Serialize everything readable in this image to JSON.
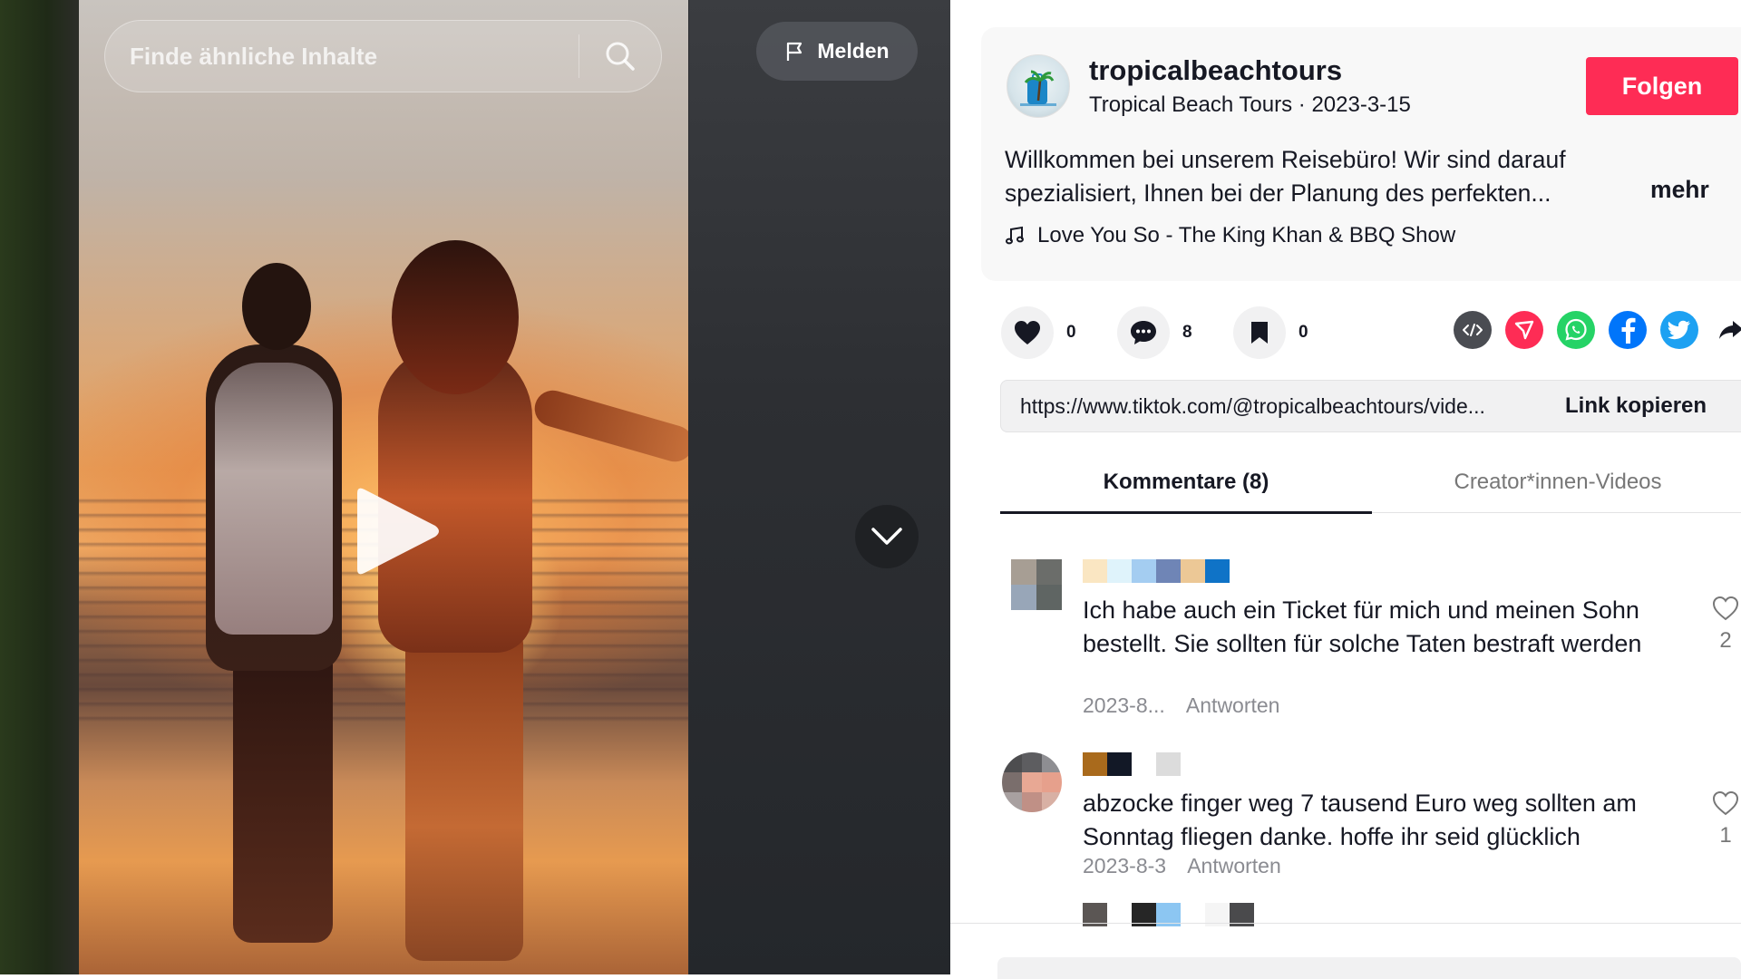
{
  "video": {
    "search_placeholder": "Finde ähnliche Inhalte",
    "report_label": "Melden"
  },
  "author": {
    "username": "tropicalbeachtours",
    "display_name": "Tropical Beach Tours",
    "separator": "·",
    "date": "2023-3-15",
    "follow_label": "Folgen",
    "description": "Willkommen bei unserem Reisebüro! Wir sind darauf spezialisiert, Ihnen bei der Planung des perfekten...",
    "more_label": "mehr",
    "music": "Love You So - The King Khan & BBQ Show"
  },
  "stats": {
    "likes": "0",
    "comments": "8",
    "saves": "0"
  },
  "share": {
    "icons": [
      "embed-icon",
      "tiktok-send-icon",
      "whatsapp-icon",
      "facebook-icon",
      "twitter-icon",
      "share-arrow-icon"
    ],
    "colors": {
      "embed": "#4a4c52",
      "send": "#fe2c55",
      "whatsapp": "#25d366",
      "facebook": "#0075fa",
      "twitter": "#1da1f2"
    }
  },
  "link": {
    "url": "https://www.tiktok.com/@tropicalbeachtours/vide...",
    "copy_label": "Link kopieren"
  },
  "tabs": {
    "comments": "Kommentare (8)",
    "creator_videos": "Creator*innen-Videos"
  },
  "comments": [
    {
      "text": "Ich habe auch ein Ticket für mich und meinen Sohn bestellt. Sie sollten für solche Taten bestraft werden",
      "date": "2023-8...",
      "reply_label": "Antworten",
      "likes": "2"
    },
    {
      "text": "abzocke finger weg 7 tausend Euro weg sollten am Sonntag fliegen danke. hoffe ihr seid glücklich",
      "date": "2023-8-3",
      "reply_label": "Antworten",
      "likes": "1"
    }
  ],
  "theme": {
    "accent": "#fe2c55",
    "text": "#161823",
    "muted": "#8a8b91"
  }
}
